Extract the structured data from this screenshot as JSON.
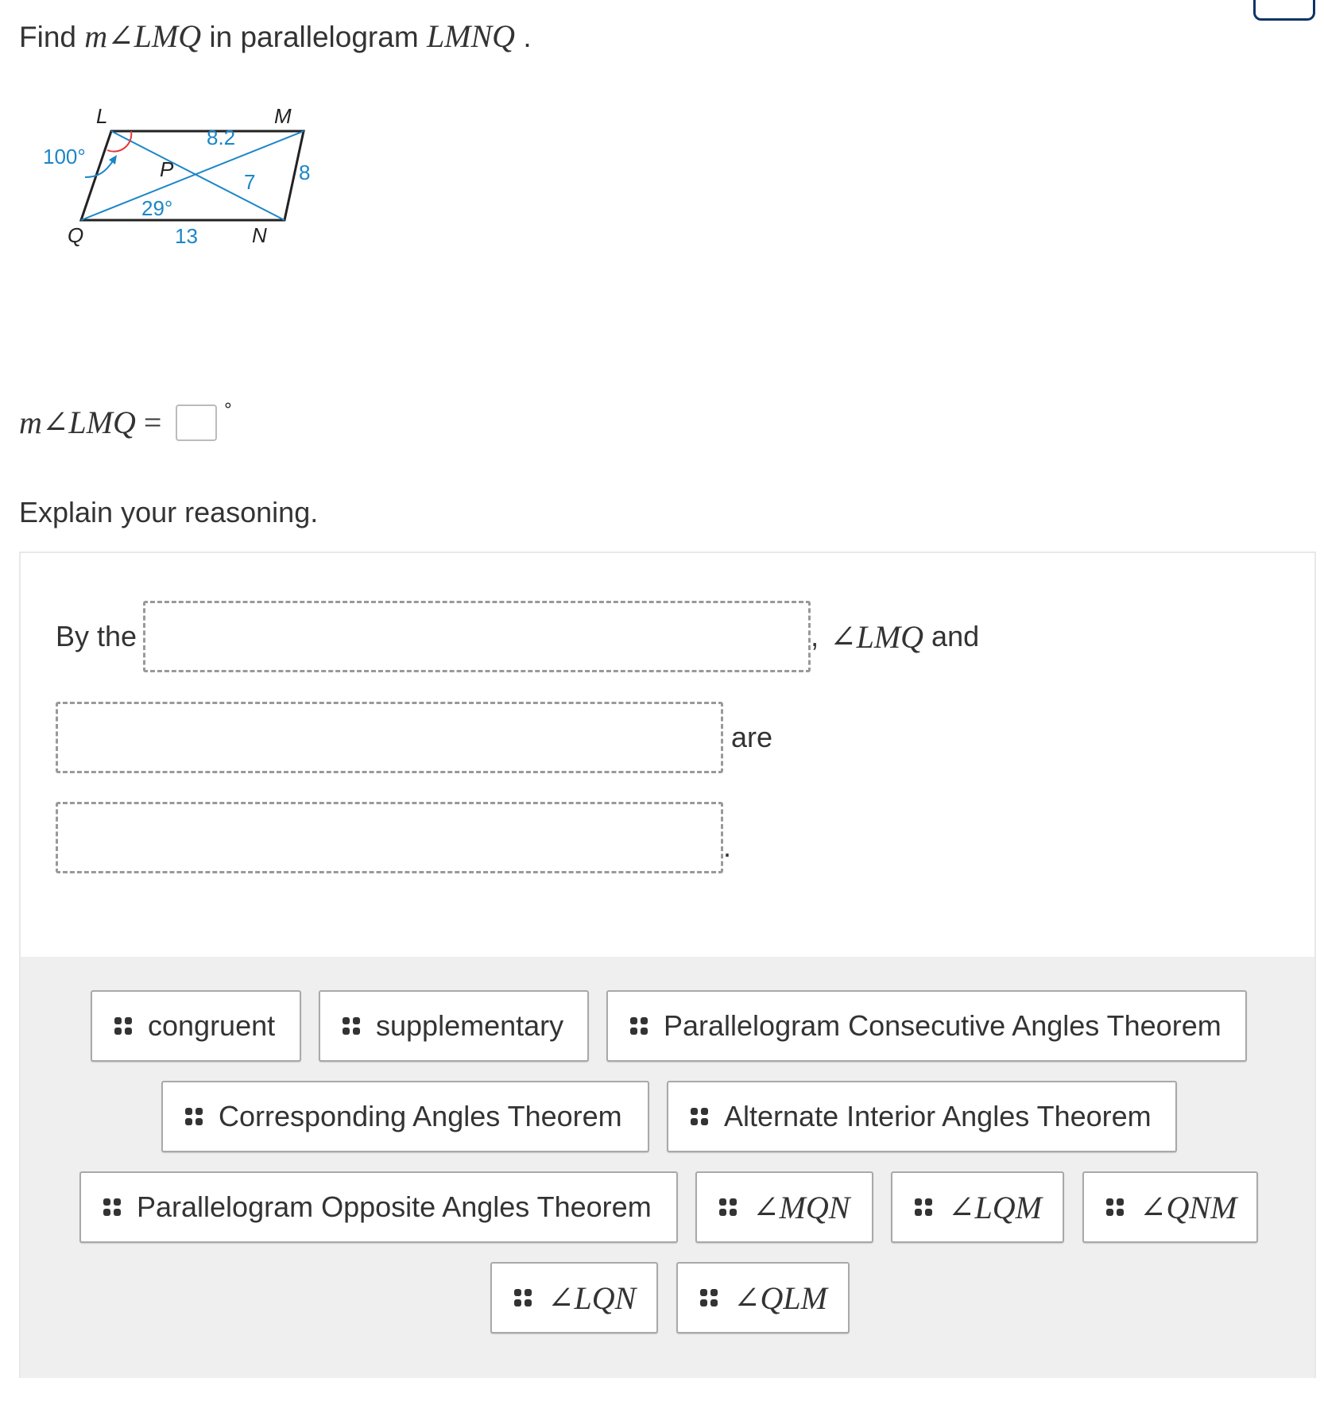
{
  "prompt": {
    "find": "Find",
    "angle_expr": "m∠LMQ",
    "in_text": "in parallelogram",
    "shape_name": "LMNQ",
    "period": "."
  },
  "figure": {
    "vertices": {
      "L": "L",
      "M": "M",
      "N": "N",
      "Q": "Q",
      "P": "P"
    },
    "labels": {
      "angle_L": "100°",
      "angle_MQN": "29°",
      "segment_MP": "8.2",
      "segment_PN": "7",
      "side_MN": "8",
      "side_QN": "13"
    },
    "colors": {
      "sides": "#222222",
      "diagonals": "#1b86c8",
      "angle_arc": "#e53935",
      "labels": "#1b86c8"
    }
  },
  "equation": {
    "lhs": "m∠LMQ",
    "equals": "=",
    "answer_value": "",
    "degree_symbol": "°"
  },
  "explain_label": "Explain your reasoning.",
  "reasoning": {
    "by_the": "By the",
    "comma": ",",
    "angle": "∠LMQ",
    "and": "and",
    "are": "are",
    "end_period": ".",
    "blanks": [
      "",
      "",
      ""
    ]
  },
  "answer_bank": [
    {
      "label": "congruent",
      "math": false
    },
    {
      "label": "supplementary",
      "math": false
    },
    {
      "label": "Parallelogram Consecutive Angles Theorem",
      "math": false
    },
    {
      "label": "Corresponding Angles Theorem",
      "math": false
    },
    {
      "label": "Alternate Interior Angles Theorem",
      "math": false
    },
    {
      "label": "Parallelogram Opposite Angles Theorem",
      "math": false
    },
    {
      "label": "∠MQN",
      "math": true
    },
    {
      "label": "∠LQM",
      "math": true
    },
    {
      "label": "∠QNM",
      "math": true
    },
    {
      "label": "∠LQN",
      "math": true
    },
    {
      "label": "∠QLM",
      "math": true
    }
  ]
}
